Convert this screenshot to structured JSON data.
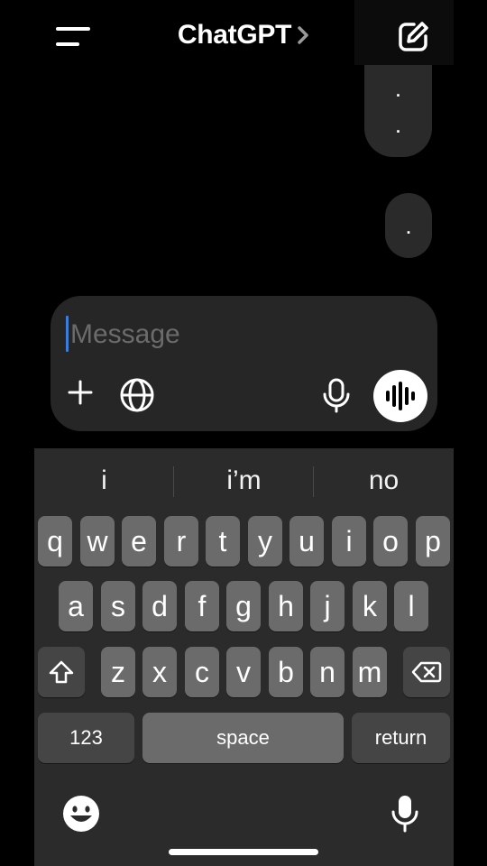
{
  "header": {
    "title": "ChatGPT",
    "menu_icon": "menu-icon",
    "title_chevron_icon": "chevron-right-icon",
    "new_chat_icon": "edit-icon"
  },
  "messages": [
    {
      "text": ".",
      "extra": "."
    },
    {
      "text": "."
    }
  ],
  "composer": {
    "placeholder": "Message",
    "value": "",
    "plus_icon": "plus-icon",
    "globe_icon": "globe-icon",
    "mic_icon": "microphone-icon",
    "voice_icon": "voice-waveform-icon"
  },
  "keyboard": {
    "suggestions": [
      "i",
      "i’m",
      "no"
    ],
    "rows": [
      [
        "q",
        "w",
        "e",
        "r",
        "t",
        "y",
        "u",
        "i",
        "o",
        "p"
      ],
      [
        "a",
        "s",
        "d",
        "f",
        "g",
        "h",
        "j",
        "k",
        "l"
      ],
      [
        "z",
        "x",
        "c",
        "v",
        "b",
        "n",
        "m"
      ]
    ],
    "shift_icon": "shift-icon",
    "delete_icon": "backspace-icon",
    "numbers_label": "123",
    "space_label": "space",
    "return_label": "return",
    "emoji_icon": "emoji-icon",
    "dictation_icon": "microphone-icon"
  },
  "colors": {
    "background": "#000000",
    "bubble": "#2a2a2a",
    "composer": "#262626",
    "caret": "#2f7ff6",
    "keyboard": "#2b2b2b",
    "key": "#6b6b6b",
    "key_dark": "#454545"
  }
}
